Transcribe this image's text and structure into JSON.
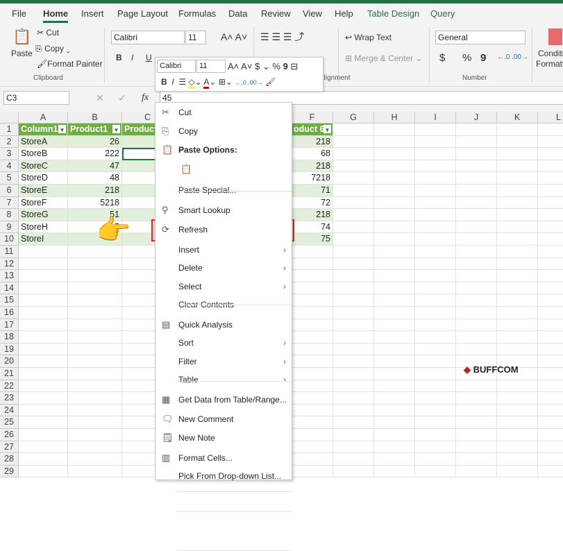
{
  "ribbon_tabs": [
    {
      "label": "File"
    },
    {
      "label": "Home",
      "active": true
    },
    {
      "label": "Insert"
    },
    {
      "label": "Page Layout"
    },
    {
      "label": "Formulas"
    },
    {
      "label": "Data"
    },
    {
      "label": "Review"
    },
    {
      "label": "View"
    },
    {
      "label": "Help"
    },
    {
      "label": "Table Design",
      "contextual": true
    },
    {
      "label": "Query",
      "contextual": true
    }
  ],
  "clipboard": {
    "paste": "Paste",
    "cut": "Cut",
    "copy": "Copy",
    "format_painter": "Format Painter",
    "group": "Clipboard"
  },
  "font": {
    "name": "Calibri",
    "size": "11",
    "bold": "B",
    "italic": "I",
    "underline": "U"
  },
  "alignment": {
    "wrap_text": "Wrap Text",
    "merge_center": "Merge & Center",
    "group": "Alignment"
  },
  "number": {
    "format": "General",
    "group": "Number",
    "currency": "$",
    "percent": "%",
    "comma": "9"
  },
  "styles": {
    "conditional": "Conditi",
    "formatting": "Formatt"
  },
  "mini_toolbar": {
    "font": "Calibri",
    "size": "11"
  },
  "formula_bar": {
    "name_box": "C3",
    "fx": "fx",
    "value": "45"
  },
  "columns": [
    "A",
    "B",
    "C",
    "D",
    "E",
    "F",
    "G",
    "H",
    "I",
    "J",
    "K",
    "L"
  ],
  "table": {
    "headers": {
      "A": "Column1",
      "B": "Product1",
      "C": "Product",
      "F": "oduct 6"
    },
    "rows": [
      {
        "A": "StoreA",
        "B": "26",
        "F": "218"
      },
      {
        "A": "StoreB",
        "B": "222",
        "F": "68"
      },
      {
        "A": "StoreC",
        "B": "47",
        "F": "218"
      },
      {
        "A": "StoreD",
        "B": "48",
        "F": "7218"
      },
      {
        "A": "StoreE",
        "B": "218",
        "F": "71"
      },
      {
        "A": "StoreF",
        "B": "5218",
        "F": "72"
      },
      {
        "A": "StoreG",
        "B": "51",
        "F": "218"
      },
      {
        "A": "StoreH",
        "B": "5",
        "F": "74"
      },
      {
        "A": "StoreI",
        "B": "",
        "F": "75"
      }
    ]
  },
  "row_count": 29,
  "context_menu": [
    {
      "label": "Cut",
      "icon": "scissors-icon"
    },
    {
      "label": "Copy",
      "icon": "copy-icon"
    },
    {
      "label": "Paste Options:",
      "icon": "paste-icon",
      "bold": true
    },
    {
      "label": "",
      "icon": "paste-text-icon"
    },
    {
      "label": "Paste Special..."
    },
    {
      "label": "Smart Lookup",
      "icon": "search-icon"
    },
    {
      "label": "Refresh",
      "icon": "refresh-icon",
      "highlighted": true
    },
    {
      "label": "Insert",
      "submenu": true
    },
    {
      "label": "Delete",
      "submenu": true
    },
    {
      "label": "Select",
      "submenu": true
    },
    {
      "label": "Clear Contents"
    },
    {
      "label": "Quick Analysis",
      "icon": "quick-analysis-icon"
    },
    {
      "label": "Sort",
      "submenu": true
    },
    {
      "label": "Filter",
      "submenu": true
    },
    {
      "label": "Table",
      "submenu": true
    },
    {
      "label": "Get Data from Table/Range...",
      "icon": "table-icon"
    },
    {
      "label": "New Comment",
      "icon": "comment-icon"
    },
    {
      "label": "New Note",
      "icon": "note-icon"
    },
    {
      "label": "Format Cells...",
      "icon": "format-cells-icon"
    },
    {
      "label": "Pick From Drop-down List..."
    }
  ],
  "watermark": "BUFFCOM",
  "colors": {
    "accent": "#217346",
    "table_header": "#70ad47",
    "band": "#e2efda",
    "highlight_border": "#d9262c"
  }
}
